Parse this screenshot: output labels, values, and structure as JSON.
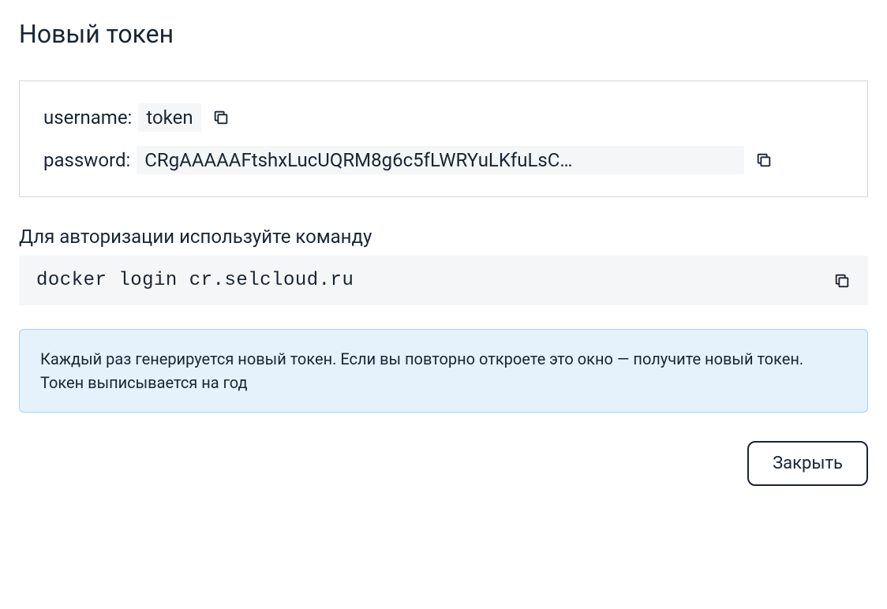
{
  "dialog": {
    "title": "Новый токен"
  },
  "credentials": {
    "username_label": "username:",
    "username_value": "token",
    "password_label": "password:",
    "password_value": "CRgAAAAAFtshxLucUQRM8g6c5fLWRYuLKfuLsC…"
  },
  "instruction": {
    "text": "Для авторизации используйте команду",
    "command": "docker login cr.selcloud.ru"
  },
  "info": {
    "text": "Каждый раз генерируется новый токен. Если вы повторно откроете это окно — получите новый токен. Токен выписывается на год"
  },
  "footer": {
    "close_label": "Закрыть"
  }
}
